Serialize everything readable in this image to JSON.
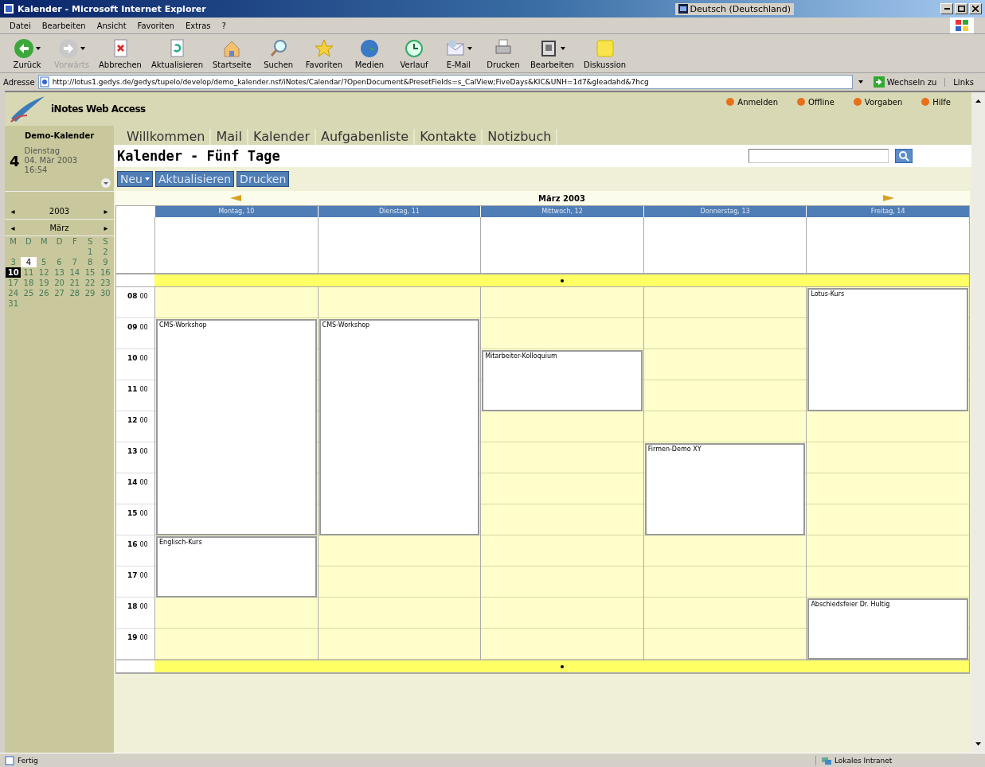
{
  "window": {
    "title": "Kalender - Microsoft Internet Explorer",
    "language": "Deutsch (Deutschland)"
  },
  "menu": [
    "Datei",
    "Bearbeiten",
    "Ansicht",
    "Favoriten",
    "Extras",
    "?"
  ],
  "toolbar": [
    {
      "kind": "back",
      "label": "Zurück",
      "disabled": false,
      "dropdown": true
    },
    {
      "kind": "forward",
      "label": "Vorwärts",
      "disabled": true,
      "dropdown": true
    },
    {
      "kind": "stop",
      "label": "Abbrechen",
      "disabled": false,
      "dropdown": false
    },
    {
      "kind": "refresh",
      "label": "Aktualisieren",
      "disabled": false,
      "dropdown": false
    },
    {
      "kind": "home",
      "label": "Startseite",
      "disabled": false,
      "dropdown": false
    },
    {
      "kind": "search",
      "label": "Suchen",
      "disabled": false,
      "dropdown": false
    },
    {
      "kind": "favorites",
      "label": "Favoriten",
      "disabled": false,
      "dropdown": false
    },
    {
      "kind": "media",
      "label": "Medien",
      "disabled": false,
      "dropdown": false
    },
    {
      "kind": "history",
      "label": "Verlauf",
      "disabled": false,
      "dropdown": false
    },
    {
      "kind": "mail",
      "label": "E-Mail",
      "disabled": false,
      "dropdown": true
    },
    {
      "kind": "print",
      "label": "Drucken",
      "disabled": false,
      "dropdown": false
    },
    {
      "kind": "edit",
      "label": "Bearbeiten",
      "disabled": false,
      "dropdown": true
    },
    {
      "kind": "discuss",
      "label": "Diskussion",
      "disabled": false,
      "dropdown": false
    }
  ],
  "address": {
    "label": "Adresse",
    "value": "http://lotus1.gedys.de/gedys/tupelo/develop/demo_kalender.nsf/iNotes/Calendar/?OpenDocument&PresetFields=s_CalView;FiveDays&KIC&UNH=1d7&gleadahd&7hcg",
    "go": "Wechseln zu",
    "links": "Links"
  },
  "app": {
    "brand": "iNotes Web Access",
    "top_links": [
      "Anmelden",
      "Offline",
      "Vorgaben",
      "Hilfe"
    ],
    "tabs": [
      "Willkommen",
      "Mail",
      "Kalender",
      "Aufgabenliste",
      "Kontakte",
      "Notizbuch"
    ]
  },
  "sidebar": {
    "title": "Demo-Kalender",
    "day_number": "4",
    "weekday": "Dienstag",
    "date": "04. Mär 2003",
    "time": "16:54",
    "year": "2003",
    "month": "März",
    "prev": "◂",
    "next": "▸",
    "weekdays": [
      "M",
      "D",
      "M",
      "D",
      "F",
      "S",
      "S"
    ],
    "weeks": [
      [
        {
          "day": "1",
          "selected": false,
          "today": false
        },
        {
          "day": "2",
          "selected": false,
          "today": false
        }
      ],
      [
        {
          "day": "3",
          "selected": false,
          "today": false
        },
        {
          "day": "4",
          "selected": false,
          "today": true
        },
        {
          "day": "5",
          "selected": false,
          "today": false
        },
        {
          "day": "6",
          "selected": false,
          "today": false
        },
        {
          "day": "7",
          "selected": false,
          "today": false
        },
        {
          "day": "8",
          "selected": false,
          "today": false
        },
        {
          "day": "9",
          "selected": false,
          "today": false
        }
      ],
      [
        {
          "day": "10",
          "selected": true,
          "today": false
        },
        {
          "day": "11",
          "selected": false,
          "today": false
        },
        {
          "day": "12",
          "selected": false,
          "today": false
        },
        {
          "day": "13",
          "selected": false,
          "today": false
        },
        {
          "day": "14",
          "selected": false,
          "today": false
        },
        {
          "day": "15",
          "selected": false,
          "today": false
        },
        {
          "day": "16",
          "selected": false,
          "today": false
        }
      ],
      [
        {
          "day": "17",
          "selected": false,
          "today": false
        },
        {
          "day": "18",
          "selected": false,
          "today": false
        },
        {
          "day": "19",
          "selected": false,
          "today": false
        },
        {
          "day": "20",
          "selected": false,
          "today": false
        },
        {
          "day": "21",
          "selected": false,
          "today": false
        },
        {
          "day": "22",
          "selected": false,
          "today": false
        },
        {
          "day": "23",
          "selected": false,
          "today": false
        }
      ],
      [
        {
          "day": "24",
          "selected": false,
          "today": false
        },
        {
          "day": "25",
          "selected": false,
          "today": false
        },
        {
          "day": "26",
          "selected": false,
          "today": false
        },
        {
          "day": "27",
          "selected": false,
          "today": false
        },
        {
          "day": "28",
          "selected": false,
          "today": false
        },
        {
          "day": "29",
          "selected": false,
          "today": false
        },
        {
          "day": "30",
          "selected": false,
          "today": false
        }
      ],
      [
        {
          "day": "31",
          "selected": false,
          "today": false
        }
      ]
    ]
  },
  "view": {
    "title": "Kalender - Fünf Tage",
    "buttons": [
      {
        "label": "Neu",
        "dropdown": true
      },
      {
        "label": "Aktualisieren",
        "dropdown": false
      },
      {
        "label": "Drucken",
        "dropdown": false
      }
    ],
    "month": "März 2003",
    "hours": [
      {
        "hour": "08",
        "minutes": "00"
      },
      {
        "hour": "09",
        "minutes": "00"
      },
      {
        "hour": "10",
        "minutes": "00"
      },
      {
        "hour": "11",
        "minutes": "00"
      },
      {
        "hour": "12",
        "minutes": "00"
      },
      {
        "hour": "13",
        "minutes": "00"
      },
      {
        "hour": "14",
        "minutes": "00"
      },
      {
        "hour": "15",
        "minutes": "00"
      },
      {
        "hour": "16",
        "minutes": "00"
      },
      {
        "hour": "17",
        "minutes": "00"
      },
      {
        "hour": "18",
        "minutes": "00"
      },
      {
        "hour": "19",
        "minutes": "00"
      }
    ],
    "days": [
      {
        "label": "Montag, 10",
        "slots": [
          {
            "kind": "free"
          },
          {
            "kind": "event",
            "title": "CMS-Workshop"
          },
          {
            "kind": "continued"
          },
          {
            "kind": "continued"
          },
          {
            "kind": "continued"
          },
          {
            "kind": "continued"
          },
          {
            "kind": "continued"
          },
          {
            "kind": "continued"
          },
          {
            "kind": "event",
            "title": "Englisch-Kurs"
          },
          {
            "kind": "continued"
          },
          {
            "kind": "free"
          },
          {
            "kind": "free"
          }
        ]
      },
      {
        "label": "Dienstag, 11",
        "slots": [
          {
            "kind": "free"
          },
          {
            "kind": "event",
            "title": "CMS-Workshop"
          },
          {
            "kind": "continued"
          },
          {
            "kind": "continued"
          },
          {
            "kind": "continued"
          },
          {
            "kind": "continued"
          },
          {
            "kind": "continued"
          },
          {
            "kind": "continued"
          },
          {
            "kind": "free"
          },
          {
            "kind": "free"
          },
          {
            "kind": "free"
          },
          {
            "kind": "free"
          }
        ]
      },
      {
        "label": "Mittwoch, 12",
        "slots": [
          {
            "kind": "free"
          },
          {
            "kind": "free"
          },
          {
            "kind": "event",
            "title": "Mitarbeiter-Kolloquium"
          },
          {
            "kind": "continued"
          },
          {
            "kind": "free"
          },
          {
            "kind": "free"
          },
          {
            "kind": "free"
          },
          {
            "kind": "free"
          },
          {
            "kind": "free"
          },
          {
            "kind": "free"
          },
          {
            "kind": "free"
          },
          {
            "kind": "free"
          }
        ]
      },
      {
        "label": "Donnerstag, 13",
        "slots": [
          {
            "kind": "free"
          },
          {
            "kind": "free"
          },
          {
            "kind": "free"
          },
          {
            "kind": "free"
          },
          {
            "kind": "free"
          },
          {
            "kind": "event",
            "title": "Firmen-Demo XY"
          },
          {
            "kind": "continued"
          },
          {
            "kind": "continued"
          },
          {
            "kind": "free"
          },
          {
            "kind": "free"
          },
          {
            "kind": "free"
          },
          {
            "kind": "free"
          }
        ]
      },
      {
        "label": "Freitag, 14",
        "slots": [
          {
            "kind": "event",
            "title": "Lotus-Kurs"
          },
          {
            "kind": "continued"
          },
          {
            "kind": "continued"
          },
          {
            "kind": "continued"
          },
          {
            "kind": "free"
          },
          {
            "kind": "free"
          },
          {
            "kind": "free"
          },
          {
            "kind": "free"
          },
          {
            "kind": "free"
          },
          {
            "kind": "free"
          },
          {
            "kind": "event",
            "title": "Abschiedsfeier Dr. Hultig"
          },
          {
            "kind": "continued"
          }
        ]
      }
    ]
  },
  "status_bar": {
    "text": "Fertig",
    "zone": "Lokales Intranet"
  }
}
